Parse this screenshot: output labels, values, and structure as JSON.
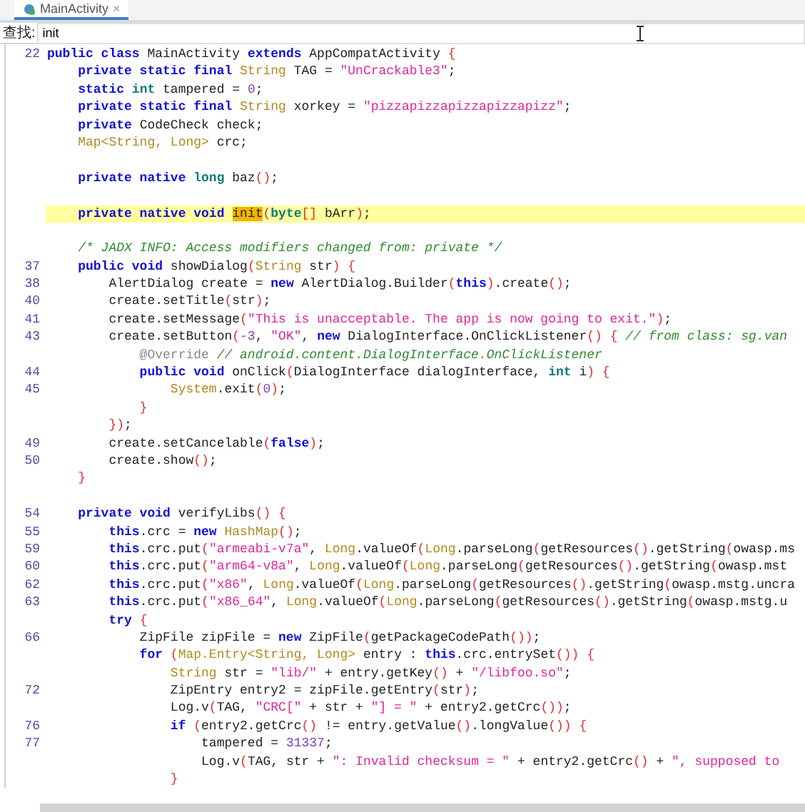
{
  "tab": {
    "label": "MainActivity",
    "selected": true,
    "close": "×"
  },
  "find": {
    "label": "查找:",
    "value": "init"
  },
  "code": [
    {
      "num": "22",
      "highlighted": false,
      "tokens": [
        {
          "kind": "kw",
          "text": "public class"
        },
        {
          "kind": "pl",
          "text": " MainActivity "
        },
        {
          "kind": "kw",
          "text": "extends"
        },
        {
          "kind": "pl",
          "text": " AppCompatActivity "
        },
        {
          "kind": "p",
          "text": "{"
        }
      ]
    },
    {
      "highlighted": false,
      "tokens": [
        {
          "kind": "kw",
          "text": "    private static final"
        },
        {
          "kind": "ty",
          "text": " String"
        },
        {
          "kind": "pl",
          "text": " TAG = "
        },
        {
          "kind": "st",
          "text": "\"UnCrackable3\""
        },
        {
          "kind": "pl",
          "text": ";"
        }
      ]
    },
    {
      "highlighted": false,
      "tokens": [
        {
          "kind": "kw",
          "text": "    static"
        },
        {
          "kind": "pr",
          "text": " int"
        },
        {
          "kind": "pl",
          "text": " tampered = "
        },
        {
          "kind": "nu",
          "text": "0"
        },
        {
          "kind": "pl",
          "text": ";"
        }
      ]
    },
    {
      "highlighted": false,
      "tokens": [
        {
          "kind": "kw",
          "text": "    private static final"
        },
        {
          "kind": "ty",
          "text": " String"
        },
        {
          "kind": "pl",
          "text": " xorkey = "
        },
        {
          "kind": "st",
          "text": "\"pizzapizzapizzapizzapizz\""
        },
        {
          "kind": "pl",
          "text": ";"
        }
      ]
    },
    {
      "highlighted": false,
      "tokens": [
        {
          "kind": "kw",
          "text": "    private"
        },
        {
          "kind": "pl",
          "text": " CodeCheck check;"
        }
      ]
    },
    {
      "highlighted": false,
      "tokens": [
        {
          "kind": "ty",
          "text": "    Map<String, Long>"
        },
        {
          "kind": "pl",
          "text": " crc;"
        }
      ]
    },
    {
      "highlighted": false
    },
    {
      "highlighted": false,
      "tokens": [
        {
          "kind": "kw",
          "text": "    private native"
        },
        {
          "kind": "pr",
          "text": " long"
        },
        {
          "kind": "pl",
          "text": " baz"
        },
        {
          "kind": "p",
          "text": "()"
        },
        {
          "kind": "pl",
          "text": ";"
        }
      ]
    },
    {
      "highlighted": false
    },
    {
      "highlighted": true,
      "tokens": [
        {
          "kind": "kw",
          "text": "    private native void "
        },
        {
          "kind": "match",
          "text": "init"
        },
        {
          "kind": "p",
          "text": "("
        },
        {
          "kind": "pr",
          "text": "byte"
        },
        {
          "kind": "p",
          "text": "[]"
        },
        {
          "kind": "pl",
          "text": " bArr"
        },
        {
          "kind": "p",
          "text": ")"
        },
        {
          "kind": "pl",
          "text": ";"
        }
      ]
    },
    {
      "highlighted": false
    },
    {
      "highlighted": false,
      "tokens": [
        {
          "kind": "c",
          "text": "    /* JADX INFO: Access modifiers changed from: private */"
        }
      ]
    },
    {
      "num": "37",
      "highlighted": false,
      "tokens": [
        {
          "kind": "kw",
          "text": "    public void"
        },
        {
          "kind": "pl",
          "text": " showDialog"
        },
        {
          "kind": "p",
          "text": "("
        },
        {
          "kind": "ty",
          "text": "String"
        },
        {
          "kind": "pl",
          "text": " str"
        },
        {
          "kind": "p",
          "text": ")"
        },
        {
          "kind": "p",
          "text": " {"
        }
      ]
    },
    {
      "num": "38",
      "highlighted": false,
      "tokens": [
        {
          "kind": "pl",
          "text": "        AlertDialog create = "
        },
        {
          "kind": "kw",
          "text": "new"
        },
        {
          "kind": "pl",
          "text": " AlertDialog.Builder"
        },
        {
          "kind": "p",
          "text": "("
        },
        {
          "kind": "kw",
          "text": "this"
        },
        {
          "kind": "p",
          "text": ")"
        },
        {
          "kind": "pl",
          "text": ".create"
        },
        {
          "kind": "p",
          "text": "()"
        },
        {
          "kind": "pl",
          "text": ";"
        }
      ]
    },
    {
      "num": "40",
      "highlighted": false,
      "tokens": [
        {
          "kind": "pl",
          "text": "        create.setTitle"
        },
        {
          "kind": "p",
          "text": "("
        },
        {
          "kind": "pl",
          "text": "str"
        },
        {
          "kind": "p",
          "text": ")"
        },
        {
          "kind": "pl",
          "text": ";"
        }
      ]
    },
    {
      "num": "41",
      "highlighted": false,
      "tokens": [
        {
          "kind": "pl",
          "text": "        create.setMessage"
        },
        {
          "kind": "p",
          "text": "("
        },
        {
          "kind": "st",
          "text": "\"This is unacceptable. The app is now going to exit.\""
        },
        {
          "kind": "p",
          "text": ")"
        },
        {
          "kind": "pl",
          "text": ";"
        }
      ]
    },
    {
      "num": "43",
      "highlighted": false,
      "tokens": [
        {
          "kind": "pl",
          "text": "        create.setButton"
        },
        {
          "kind": "p",
          "text": "("
        },
        {
          "kind": "nu",
          "text": "-3"
        },
        {
          "kind": "pl",
          "text": ", "
        },
        {
          "kind": "st",
          "text": "\"OK\""
        },
        {
          "kind": "pl",
          "text": ", "
        },
        {
          "kind": "kw",
          "text": "new"
        },
        {
          "kind": "pl",
          "text": " DialogInterface.OnClickListener"
        },
        {
          "kind": "p",
          "text": "()"
        },
        {
          "kind": "p",
          "text": " {"
        },
        {
          "kind": "c",
          "text": " // from class: sg.van"
        }
      ]
    },
    {
      "highlighted": false,
      "tokens": [
        {
          "kind": "an",
          "text": "            @Override"
        },
        {
          "kind": "c",
          "text": " // android.content.DialogInterface.OnClickListener"
        }
      ]
    },
    {
      "num": "44",
      "highlighted": false,
      "tokens": [
        {
          "kind": "kw",
          "text": "            public void"
        },
        {
          "kind": "pl",
          "text": " onClick"
        },
        {
          "kind": "p",
          "text": "("
        },
        {
          "kind": "pl",
          "text": "DialogInterface dialogInterface, "
        },
        {
          "kind": "pr",
          "text": "int"
        },
        {
          "kind": "pl",
          "text": " i"
        },
        {
          "kind": "p",
          "text": ")"
        },
        {
          "kind": "p",
          "text": " {"
        }
      ]
    },
    {
      "num": "45",
      "highlighted": false,
      "tokens": [
        {
          "kind": "ty",
          "text": "                System"
        },
        {
          "kind": "pl",
          "text": ".exit"
        },
        {
          "kind": "p",
          "text": "("
        },
        {
          "kind": "nu",
          "text": "0"
        },
        {
          "kind": "p",
          "text": ")"
        },
        {
          "kind": "pl",
          "text": ";"
        }
      ]
    },
    {
      "highlighted": false,
      "tokens": [
        {
          "kind": "p",
          "text": "            }"
        }
      ]
    },
    {
      "highlighted": false,
      "tokens": [
        {
          "kind": "p",
          "text": "        })"
        },
        {
          "kind": "pl",
          "text": ";"
        }
      ]
    },
    {
      "num": "49",
      "highlighted": false,
      "tokens": [
        {
          "kind": "pl",
          "text": "        create.setCancelable"
        },
        {
          "kind": "p",
          "text": "("
        },
        {
          "kind": "kw",
          "text": "false"
        },
        {
          "kind": "p",
          "text": ")"
        },
        {
          "kind": "pl",
          "text": ";"
        }
      ]
    },
    {
      "num": "50",
      "highlighted": false,
      "tokens": [
        {
          "kind": "pl",
          "text": "        create.show"
        },
        {
          "kind": "p",
          "text": "()"
        },
        {
          "kind": "pl",
          "text": ";"
        }
      ]
    },
    {
      "highlighted": false,
      "tokens": [
        {
          "kind": "p",
          "text": "    }"
        }
      ]
    },
    {
      "highlighted": false
    },
    {
      "num": "54",
      "highlighted": false,
      "tokens": [
        {
          "kind": "kw",
          "text": "    private void"
        },
        {
          "kind": "pl",
          "text": " verifyLibs"
        },
        {
          "kind": "p",
          "text": "()"
        },
        {
          "kind": "p",
          "text": " {"
        }
      ]
    },
    {
      "num": "55",
      "highlighted": false,
      "tokens": [
        {
          "kind": "kw",
          "text": "        this"
        },
        {
          "kind": "pl",
          "text": ".crc = "
        },
        {
          "kind": "kw",
          "text": "new"
        },
        {
          "kind": "ty",
          "text": " HashMap"
        },
        {
          "kind": "p",
          "text": "()"
        },
        {
          "kind": "pl",
          "text": ";"
        }
      ]
    },
    {
      "num": "59",
      "highlighted": false,
      "tokens": [
        {
          "kind": "kw",
          "text": "        this"
        },
        {
          "kind": "pl",
          "text": ".crc.put"
        },
        {
          "kind": "p",
          "text": "("
        },
        {
          "kind": "st",
          "text": "\"armeabi-v7a\""
        },
        {
          "kind": "pl",
          "text": ", "
        },
        {
          "kind": "ty",
          "text": "Long"
        },
        {
          "kind": "pl",
          "text": ".valueOf"
        },
        {
          "kind": "p",
          "text": "("
        },
        {
          "kind": "ty",
          "text": "Long"
        },
        {
          "kind": "pl",
          "text": ".parseLong"
        },
        {
          "kind": "p",
          "text": "("
        },
        {
          "kind": "pl",
          "text": "getResources"
        },
        {
          "kind": "p",
          "text": "()"
        },
        {
          "kind": "pl",
          "text": ".getString"
        },
        {
          "kind": "p",
          "text": "("
        },
        {
          "kind": "pl",
          "text": "owasp.ms"
        }
      ]
    },
    {
      "num": "60",
      "highlighted": false,
      "tokens": [
        {
          "kind": "kw",
          "text": "        this"
        },
        {
          "kind": "pl",
          "text": ".crc.put"
        },
        {
          "kind": "p",
          "text": "("
        },
        {
          "kind": "st",
          "text": "\"arm64-v8a\""
        },
        {
          "kind": "pl",
          "text": ", "
        },
        {
          "kind": "ty",
          "text": "Long"
        },
        {
          "kind": "pl",
          "text": ".valueOf"
        },
        {
          "kind": "p",
          "text": "("
        },
        {
          "kind": "ty",
          "text": "Long"
        },
        {
          "kind": "pl",
          "text": ".parseLong"
        },
        {
          "kind": "p",
          "text": "("
        },
        {
          "kind": "pl",
          "text": "getResources"
        },
        {
          "kind": "p",
          "text": "()"
        },
        {
          "kind": "pl",
          "text": ".getString"
        },
        {
          "kind": "p",
          "text": "("
        },
        {
          "kind": "pl",
          "text": "owasp.mst"
        }
      ]
    },
    {
      "num": "62",
      "highlighted": false,
      "tokens": [
        {
          "kind": "kw",
          "text": "        this"
        },
        {
          "kind": "pl",
          "text": ".crc.put"
        },
        {
          "kind": "p",
          "text": "("
        },
        {
          "kind": "st",
          "text": "\"x86\""
        },
        {
          "kind": "pl",
          "text": ", "
        },
        {
          "kind": "ty",
          "text": "Long"
        },
        {
          "kind": "pl",
          "text": ".valueOf"
        },
        {
          "kind": "p",
          "text": "("
        },
        {
          "kind": "ty",
          "text": "Long"
        },
        {
          "kind": "pl",
          "text": ".parseLong"
        },
        {
          "kind": "p",
          "text": "("
        },
        {
          "kind": "pl",
          "text": "getResources"
        },
        {
          "kind": "p",
          "text": "()"
        },
        {
          "kind": "pl",
          "text": ".getString"
        },
        {
          "kind": "p",
          "text": "("
        },
        {
          "kind": "pl",
          "text": "owasp.mstg.uncra"
        }
      ]
    },
    {
      "num": "63",
      "highlighted": false,
      "tokens": [
        {
          "kind": "kw",
          "text": "        this"
        },
        {
          "kind": "pl",
          "text": ".crc.put"
        },
        {
          "kind": "p",
          "text": "("
        },
        {
          "kind": "st",
          "text": "\"x86_64\""
        },
        {
          "kind": "pl",
          "text": ", "
        },
        {
          "kind": "ty",
          "text": "Long"
        },
        {
          "kind": "pl",
          "text": ".valueOf"
        },
        {
          "kind": "p",
          "text": "("
        },
        {
          "kind": "ty",
          "text": "Long"
        },
        {
          "kind": "pl",
          "text": ".parseLong"
        },
        {
          "kind": "p",
          "text": "("
        },
        {
          "kind": "pl",
          "text": "getResources"
        },
        {
          "kind": "p",
          "text": "()"
        },
        {
          "kind": "pl",
          "text": ".getString"
        },
        {
          "kind": "p",
          "text": "("
        },
        {
          "kind": "pl",
          "text": "owasp.mstg.u"
        }
      ]
    },
    {
      "highlighted": false,
      "tokens": [
        {
          "kind": "kw",
          "text": "        try"
        },
        {
          "kind": "p",
          "text": " {"
        }
      ]
    },
    {
      "num": "66",
      "highlighted": false,
      "tokens": [
        {
          "kind": "pl",
          "text": "            ZipFile zipFile = "
        },
        {
          "kind": "kw",
          "text": "new"
        },
        {
          "kind": "pl",
          "text": " ZipFile"
        },
        {
          "kind": "p",
          "text": "("
        },
        {
          "kind": "pl",
          "text": "getPackageCodePath"
        },
        {
          "kind": "p",
          "text": "())"
        },
        {
          "kind": "pl",
          "text": ";"
        }
      ]
    },
    {
      "highlighted": false,
      "tokens": [
        {
          "kind": "kw",
          "text": "            for"
        },
        {
          "kind": "p",
          "text": " ("
        },
        {
          "kind": "ty",
          "text": "Map.Entry<String, Long>"
        },
        {
          "kind": "pl",
          "text": " entry : "
        },
        {
          "kind": "kw",
          "text": "this"
        },
        {
          "kind": "pl",
          "text": ".crc.entrySet"
        },
        {
          "kind": "p",
          "text": "())"
        },
        {
          "kind": "p",
          "text": " {"
        }
      ]
    },
    {
      "highlighted": false,
      "tokens": [
        {
          "kind": "ty",
          "text": "                String"
        },
        {
          "kind": "pl",
          "text": " str = "
        },
        {
          "kind": "st",
          "text": "\"lib/\""
        },
        {
          "kind": "pl",
          "text": " + entry.getKey"
        },
        {
          "kind": "p",
          "text": "()"
        },
        {
          "kind": "pl",
          "text": " + "
        },
        {
          "kind": "st",
          "text": "\"/libfoo.so\""
        },
        {
          "kind": "pl",
          "text": ";"
        }
      ]
    },
    {
      "num": "72",
      "highlighted": false,
      "tokens": [
        {
          "kind": "pl",
          "text": "                ZipEntry entry2 = zipFile.getEntry"
        },
        {
          "kind": "p",
          "text": "("
        },
        {
          "kind": "pl",
          "text": "str"
        },
        {
          "kind": "p",
          "text": ")"
        },
        {
          "kind": "pl",
          "text": ";"
        }
      ]
    },
    {
      "highlighted": false,
      "tokens": [
        {
          "kind": "pl",
          "text": "                Log.v"
        },
        {
          "kind": "p",
          "text": "("
        },
        {
          "kind": "pl",
          "text": "TAG, "
        },
        {
          "kind": "st",
          "text": "\"CRC[\""
        },
        {
          "kind": "pl",
          "text": " + str + "
        },
        {
          "kind": "st",
          "text": "\"] = \""
        },
        {
          "kind": "pl",
          "text": " + entry2.getCrc"
        },
        {
          "kind": "p",
          "text": "())"
        },
        {
          "kind": "pl",
          "text": ";"
        }
      ]
    },
    {
      "num": "76",
      "highlighted": false,
      "tokens": [
        {
          "kind": "kw",
          "text": "                if"
        },
        {
          "kind": "p",
          "text": " ("
        },
        {
          "kind": "pl",
          "text": "entry2.getCrc"
        },
        {
          "kind": "p",
          "text": "()"
        },
        {
          "kind": "pl",
          "text": " != entry.getValue"
        },
        {
          "kind": "p",
          "text": "()"
        },
        {
          "kind": "pl",
          "text": ".longValue"
        },
        {
          "kind": "p",
          "text": "())"
        },
        {
          "kind": "p",
          "text": " {"
        }
      ]
    },
    {
      "num": "77",
      "highlighted": false,
      "tokens": [
        {
          "kind": "pl",
          "text": "                    tampered = "
        },
        {
          "kind": "nu",
          "text": "31337"
        },
        {
          "kind": "pl",
          "text": ";"
        }
      ]
    },
    {
      "highlighted": false,
      "tokens": [
        {
          "kind": "pl",
          "text": "                    Log.v"
        },
        {
          "kind": "p",
          "text": "("
        },
        {
          "kind": "pl",
          "text": "TAG, str + "
        },
        {
          "kind": "st",
          "text": "\": Invalid checksum = \""
        },
        {
          "kind": "pl",
          "text": " + entry2.getCrc"
        },
        {
          "kind": "p",
          "text": "()"
        },
        {
          "kind": "pl",
          "text": " + "
        },
        {
          "kind": "st",
          "text": "\", supposed to"
        }
      ]
    },
    {
      "highlighted": false,
      "tokens": [
        {
          "kind": "p",
          "text": "                }"
        }
      ]
    }
  ]
}
